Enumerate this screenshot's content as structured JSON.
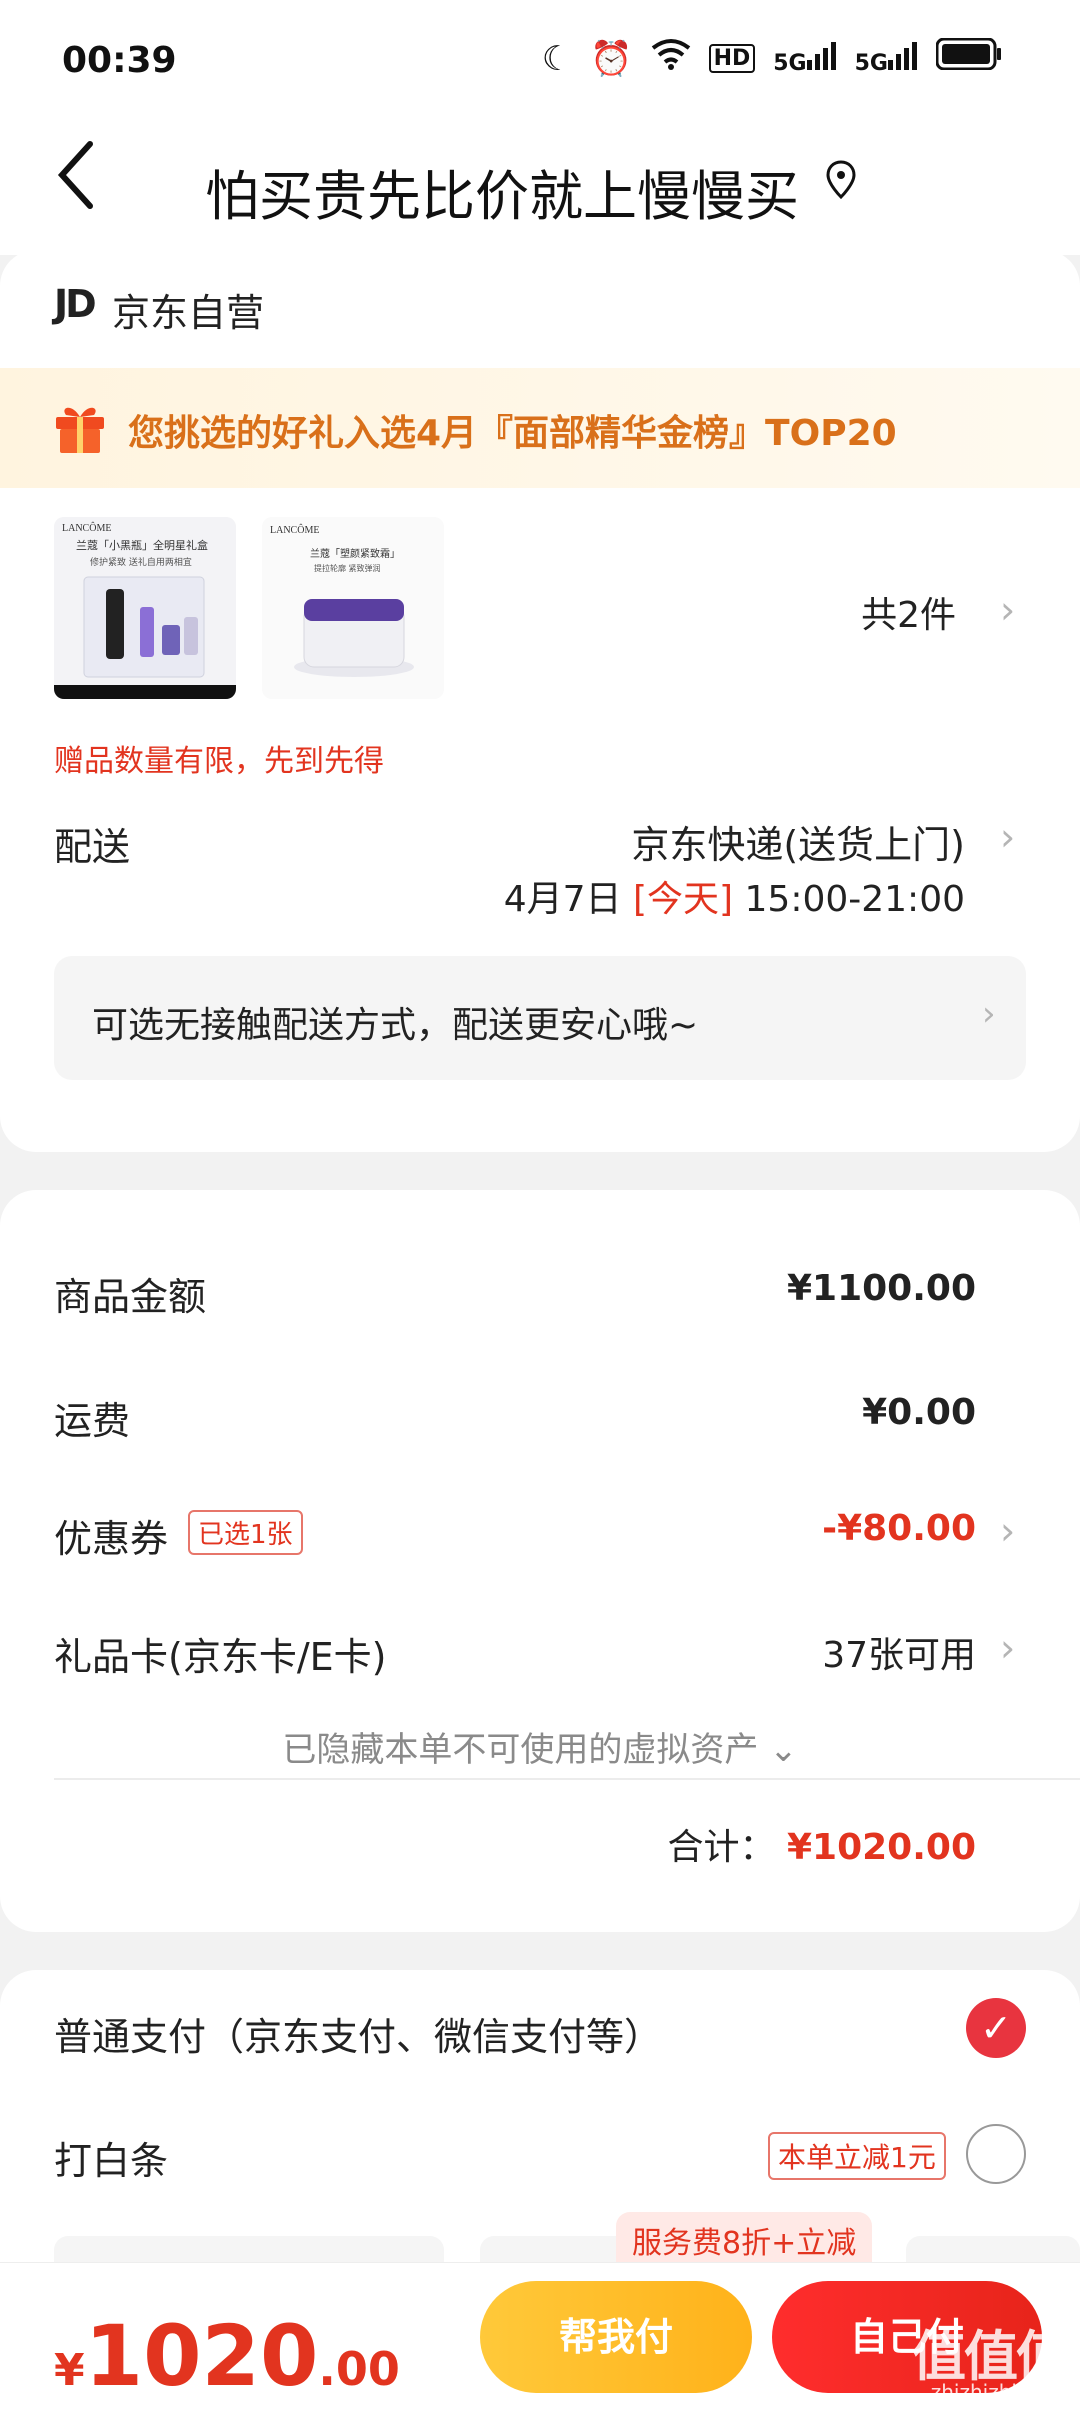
{
  "status_bar": {
    "time": "00:39",
    "icons": [
      "moon-icon",
      "alarm-icon",
      "wifi-icon",
      "hd-icon",
      "signal-5g-icon",
      "signal-5g-icon",
      "battery-icon"
    ],
    "hd_label": "HD",
    "net1": "5G",
    "net2": "5G"
  },
  "nav": {
    "back_icon": "back-chevron-icon",
    "title": "怕买贵先比价就上慢慢买",
    "location_icon": "location-pin-icon"
  },
  "shop": {
    "logo_text": "JD",
    "name": "京东自营"
  },
  "banner": {
    "icon": "gift-icon",
    "text": "您挑选的好礼入选4月『面部精华金榜』TOP20"
  },
  "products": {
    "items": [
      {
        "brand": "LANCÔME",
        "caption": "兰蔻「小黑瓶」全明星礼盒",
        "sub": "修护紧致 送礼自用两相宜"
      },
      {
        "brand": "LANCÔME",
        "caption": "兰蔻「塑颜紧致霜」",
        "sub": "提拉轮廓 紧致弹润"
      }
    ],
    "count_label": "共2件",
    "gift_note": "赠品数量有限，先到先得"
  },
  "delivery": {
    "label": "配送",
    "method": "京东快递(送货上门)",
    "date": "4月7日",
    "today": "[今天]",
    "window": "15:00-21:00",
    "contactless": "可选无接触配送方式，配送更安心哦~"
  },
  "summary": {
    "goods_label": "商品金额",
    "goods_value": "¥1100.00",
    "shipping_label": "运费",
    "shipping_value": "¥0.00",
    "coupon_label": "优惠券",
    "coupon_badge": "已选1张",
    "coupon_value": "-¥80.00",
    "giftcard_label": "礼品卡(京东卡/E卡)",
    "giftcard_value": "37张可用",
    "hidden_assets": "已隐藏本单不可使用的虚拟资产 ⌄",
    "total_label": "合计：",
    "total_value": "¥1020.00"
  },
  "payment": {
    "normal_label": "普通支付（京东支付、微信支付等）",
    "baitiao_label": "打白条",
    "baitiao_promo": "本单立减1元",
    "service_tag": "服务费8折+立减"
  },
  "bottom": {
    "currency": "¥",
    "price_int": "1020",
    "price_dec": ".00",
    "help_pay": "帮我付",
    "self_pay": "自己付"
  },
  "watermark": {
    "text": "值值值",
    "url": "zhizhizhi.com"
  }
}
